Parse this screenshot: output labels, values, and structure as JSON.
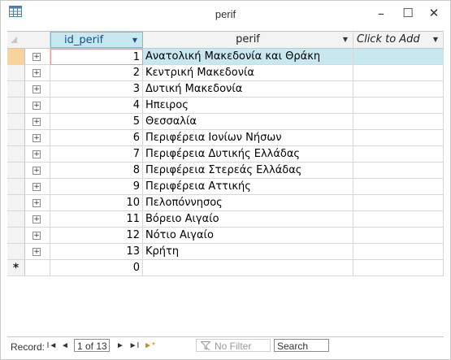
{
  "window": {
    "title": "perif",
    "icon": "datasheet-icon",
    "minimize_glyph": "–",
    "maximize_glyph": "☐",
    "close_glyph": "✕"
  },
  "grid": {
    "columns": [
      {
        "label": "id_perif",
        "arrow": "▼"
      },
      {
        "label": "perif",
        "arrow": "▼"
      },
      {
        "label": "Click to Add",
        "arrow": "▼"
      }
    ],
    "rows": [
      {
        "id": "1",
        "name": "Ανατολική Μακεδονία και Θράκη"
      },
      {
        "id": "2",
        "name": "Κεντρική Μακεδονία"
      },
      {
        "id": "3",
        "name": "Δυτική Μακεδονία"
      },
      {
        "id": "4",
        "name": "Ηπειρος"
      },
      {
        "id": "5",
        "name": "Θεσσαλία"
      },
      {
        "id": "6",
        "name": "Περιφέρεια Ιονίων Νήσων"
      },
      {
        "id": "7",
        "name": "Περιφέρεια Δυτικής Ελλάδας"
      },
      {
        "id": "8",
        "name": "Περιφέρεια Στερεάς Ελλάδας"
      },
      {
        "id": "9",
        "name": "Περιφέρεια Αττικής"
      },
      {
        "id": "10",
        "name": "Πελοπόννησος"
      },
      {
        "id": "11",
        "name": "Βόρειο Αιγαίο"
      },
      {
        "id": "12",
        "name": "Νότιο Αιγαίο"
      },
      {
        "id": "13",
        "name": "Κρήτη"
      }
    ],
    "new_row": {
      "marker": "*",
      "id": "0"
    },
    "expand_glyph": "+"
  },
  "navigation": {
    "label": "Record:",
    "first": "I◄",
    "prev": "◄",
    "position": "1 of 13",
    "next": "►",
    "last": "►I",
    "new": "►*",
    "filter_label": "No Filter",
    "search_label": "Search"
  },
  "colors": {
    "header_selected": "#c7e8ef",
    "current_row_selector": "#f7d59a"
  }
}
